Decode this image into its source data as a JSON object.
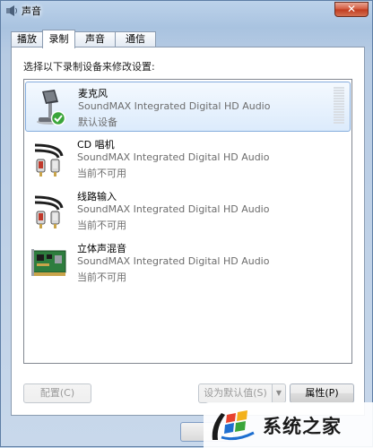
{
  "window": {
    "title": "声音",
    "close_label": "✕"
  },
  "tabs": [
    {
      "label": "播放",
      "active": false
    },
    {
      "label": "录制",
      "active": true
    },
    {
      "label": "声音",
      "active": false
    },
    {
      "label": "通信",
      "active": false
    }
  ],
  "instruction": "选择以下录制设备来修改设置:",
  "devices": [
    {
      "name": "麦克风",
      "description": "SoundMAX Integrated Digital HD Audio",
      "status": "默认设备",
      "icon": "microphone-icon",
      "selected": true
    },
    {
      "name": "CD 唱机",
      "description": "SoundMAX Integrated Digital HD Audio",
      "status": "当前不可用",
      "icon": "audio-cable-icon"
    },
    {
      "name": "线路输入",
      "description": "SoundMAX Integrated Digital HD Audio",
      "status": "当前不可用",
      "icon": "audio-cable-icon"
    },
    {
      "name": "立体声混音",
      "description": "SoundMAX Integrated Digital HD Audio",
      "status": "当前不可用",
      "icon": "sound-card-icon"
    }
  ],
  "buttons": {
    "configure": "配置(C)",
    "set_default": "设为默认值(S)",
    "properties": "属性(P)"
  },
  "watermark": {
    "text": "系统之家",
    "icon": "windows-logo-icon"
  },
  "colors": {
    "selection": "#dcebfc",
    "default_check": "#3aa53a",
    "watermark_blue": "#1e6fd0"
  }
}
